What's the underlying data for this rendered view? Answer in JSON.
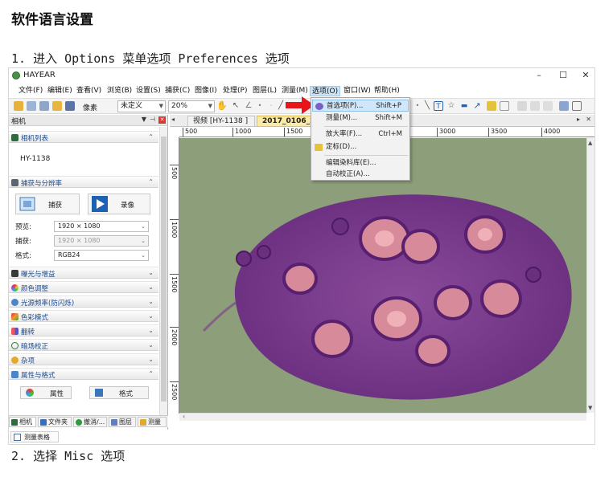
{
  "doc": {
    "title": "软件语言设置",
    "step1": "1. 进入 Options 菜单选项 Preferences 选项",
    "step2": "2. 选择 Misc 选项"
  },
  "app": {
    "name": "HAYEAR",
    "window_controls": [
      "–",
      "☐",
      "✕"
    ]
  },
  "menubar": [
    "文件(F)",
    "编辑(E)",
    "查看(V)",
    "浏览(B)",
    "设置(S)",
    "捕获(C)",
    "图像(I)",
    "处理(P)",
    "图层(L)",
    "测量(M)",
    "选项(O)",
    "窗口(W)",
    "帮助(H)"
  ],
  "toolbar": {
    "unit_label": "像素",
    "calibration_value": "未定义",
    "zoom_value": "20%"
  },
  "panel": {
    "title": "相机",
    "sections": {
      "camera_list": "相机列表",
      "capture": "捕获与分辨率",
      "exposure": "曝光与增益",
      "color_adjust": "颜色调整",
      "light_freq": "光源频率(防闪烁)",
      "color_mode": "色彩模式",
      "flip": "翻转",
      "dark_field": "暗场校正",
      "misc": "杂项",
      "props": "属性与格式"
    },
    "camera_name": "HY-1138",
    "capture_button": "捕获",
    "record_button": "录像",
    "preview_label": "预览:",
    "preview_value": "1920 × 1080",
    "capture_label": "捕获:",
    "capture_value": "1920 × 1080",
    "format_label": "格式:",
    "format_value": "RGB24",
    "attr_button": "属性",
    "fmt_button": "格式"
  },
  "bottom_tabs": [
    "相机",
    "文件夹",
    "撤消/...",
    "图层",
    "测量"
  ],
  "measure_tab": "测量表格",
  "doc_tabs": [
    "视频 [HY-1138 ]",
    "2017_0106_23"
  ],
  "ruler_h": [
    "500",
    "1000",
    "1500",
    "3000",
    "3500",
    "4000"
  ],
  "ruler_v": [
    "500",
    "1000",
    "1500",
    "2000",
    "2500"
  ],
  "options_menu": {
    "items": [
      {
        "label": "首选项(P)...",
        "shortcut": "Shift+P"
      },
      {
        "label": "测量(M)...",
        "shortcut": "Shift+M"
      },
      {
        "label": "放大率(F)...",
        "shortcut": "Ctrl+M"
      },
      {
        "label": "定标(D)...",
        "shortcut": ""
      },
      {
        "label": "编辑染料库(E)...",
        "shortcut": ""
      },
      {
        "label": "自动校正(A)...",
        "shortcut": ""
      }
    ]
  },
  "colors": {
    "accent": "#1f4c8f",
    "menu_highlight": "#cfe6fb",
    "arrow": "#e8161b",
    "tissue": "#7a3a8c",
    "canvas_bg": "#8c9e7a"
  }
}
